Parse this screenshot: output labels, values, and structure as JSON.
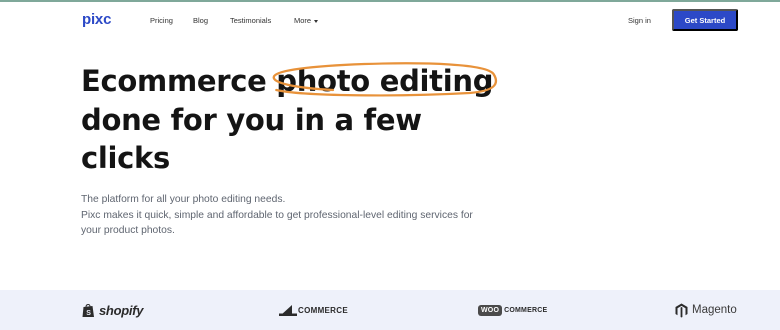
{
  "nav": {
    "logo": "pixc",
    "links": [
      "Pricing",
      "Blog",
      "Testimonials"
    ],
    "more_label": "More",
    "signin_label": "Sign in",
    "cta_label": "Get Started"
  },
  "hero": {
    "title_before": "Ecommerce ",
    "title_highlight": "photo editing",
    "title_after": "done for you in a few clicks",
    "subtitle_line1": "The platform for all your photo editing needs.",
    "subtitle_line2": "Pixc makes it quick, simple and affordable to get professional-level editing services for your product photos."
  },
  "brands": {
    "shopify": "shopify",
    "bigcommerce": "COMMERCE",
    "woo_badge": "WOO",
    "woo_text": "COMMERCE",
    "magento": "Magento"
  },
  "colors": {
    "brand_blue": "#2c49c7",
    "scribble_orange": "#e8923a",
    "strip_bg": "#eef1fa",
    "top_border": "#7fa89a"
  }
}
